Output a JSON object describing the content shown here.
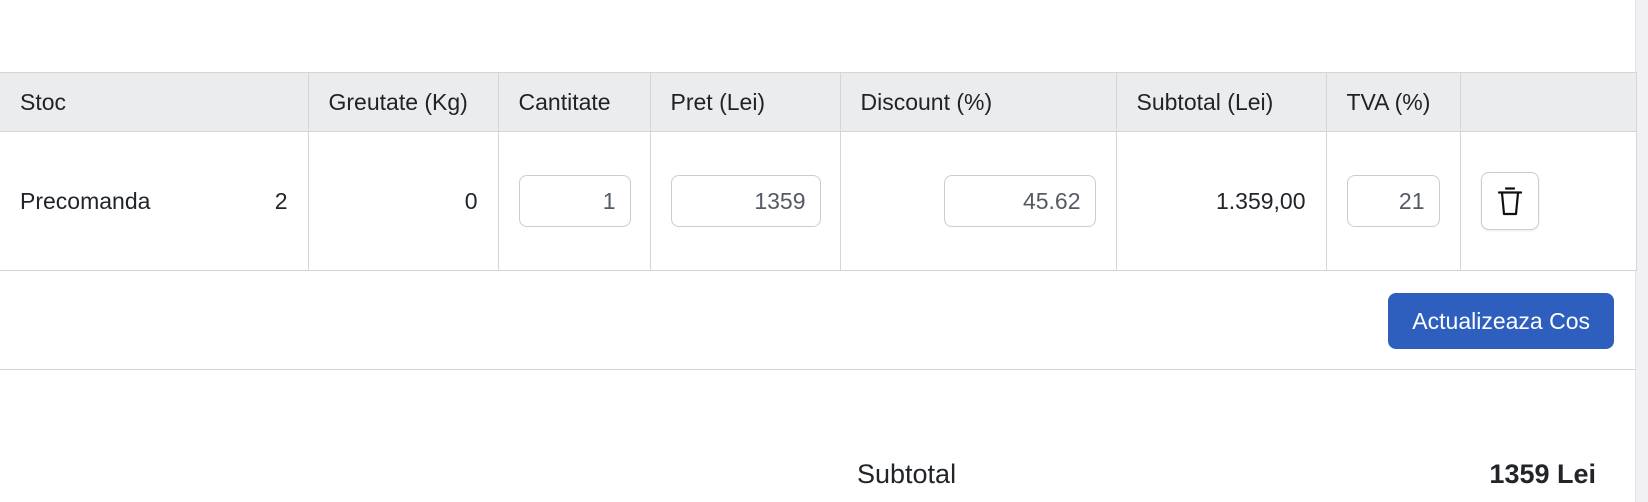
{
  "table": {
    "headers": {
      "stoc": "Stoc",
      "greutate": "Greutate (Kg)",
      "cantitate": "Cantitate",
      "pret": "Pret (Lei)",
      "discount": "Discount (%)",
      "subtotal": "Subtotal (Lei)",
      "tva": "TVA (%)",
      "actions": ""
    },
    "row": {
      "stoc_status": "Precomanda",
      "stoc_count": "2",
      "greutate": "0",
      "cantitate": "1",
      "pret": "1359",
      "discount": "45.62",
      "subtotal": "1.359,00",
      "tva": "21",
      "delete_icon": "trash-icon"
    }
  },
  "actions": {
    "update_cart_label": "Actualizeaza Cos"
  },
  "summary": {
    "subtotal_label": "Subtotal",
    "subtotal_value": "1359 Lei"
  },
  "colors": {
    "primary_button": "#2e5fbf",
    "header_background": "#ebecee",
    "border": "#d3d5d9"
  }
}
